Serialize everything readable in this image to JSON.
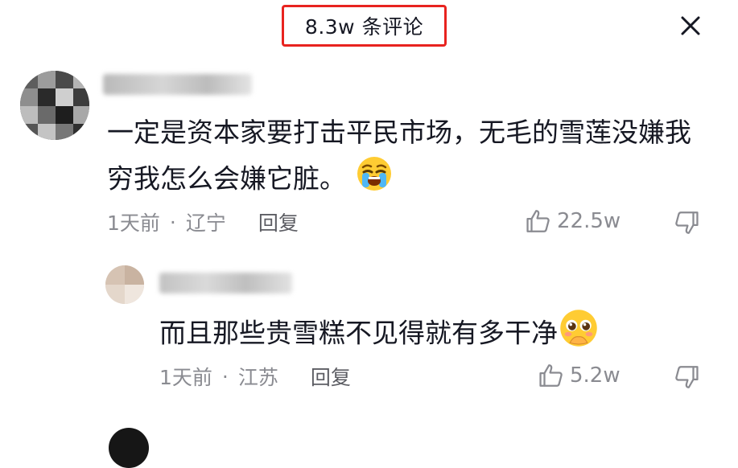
{
  "header": {
    "title": "8.3w 条评论"
  },
  "comments": [
    {
      "text": "一定是资本家要打击平民市场，无毛的雪莲没嫌我穷我怎么会嫌它脏。",
      "emoji": "loudly-crying-face-emoji",
      "time": "1天前",
      "location": "辽宁",
      "reply_label": "回复",
      "likes": "22.5w",
      "reply": {
        "text": "而且那些贵雪糕不见得就有多干净",
        "emoji": "pleading-face-emoji",
        "time": "1天前",
        "location": "江苏",
        "reply_label": "回复",
        "likes": "5.2w"
      }
    }
  ],
  "colors": {
    "highlight_border": "#e8231f",
    "meta_text": "#8a8b91",
    "primary_text": "#161823"
  },
  "icons": [
    "close-icon",
    "thumbs-up-icon",
    "thumbs-down-icon"
  ]
}
